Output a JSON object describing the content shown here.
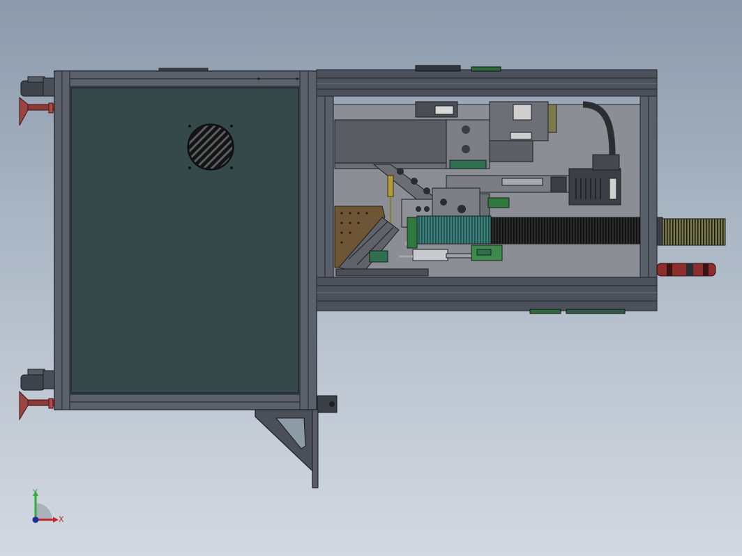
{
  "view": {
    "background_top": "#8c9aab",
    "background_bottom": "#d3d9e1",
    "line_color": "#2a2d33",
    "frame_color": "#4a505a",
    "panel_color": "#36494a",
    "interior_color": "#8b8e95"
  },
  "triad": {
    "x_label": "X",
    "y_label": "Y",
    "x_color": "#c0262b",
    "y_color": "#2fae3c",
    "z_color": "#1f2f9a"
  },
  "parts": {
    "fan_grille": "fan-grille-icon",
    "leveling_feet": "leveling-foot-icon",
    "casters": "caster-icon",
    "bellows": "bellows-hose",
    "cable": "drag-cable"
  }
}
